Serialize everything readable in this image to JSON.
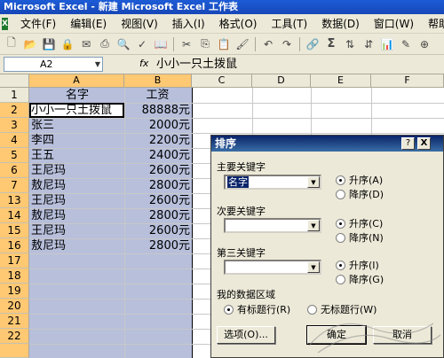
{
  "window": {
    "title": "Microsoft Excel - 新建 Microsoft Excel 工作表"
  },
  "menu": {
    "app_icon": "X",
    "items": [
      "文件(F)",
      "编辑(E)",
      "视图(V)",
      "插入(I)",
      "格式(O)",
      "工具(T)",
      "数据(D)",
      "窗口(W)",
      "帮助(H)"
    ]
  },
  "toolbar": {
    "sigma": "Σ"
  },
  "formula": {
    "cell_ref": "A2",
    "fx": "fx",
    "content": "小小一只土拨鼠"
  },
  "sheet": {
    "columns": [
      "A",
      "B",
      "C",
      "D",
      "E",
      "F"
    ],
    "row_numbers": [
      "1",
      "2",
      "3",
      "4",
      "5",
      "6",
      "7",
      "13",
      "14",
      "15",
      "16",
      "17",
      "18",
      "19",
      "20",
      "21",
      "22"
    ],
    "header": {
      "a": "名字",
      "b": "工资"
    },
    "rows": [
      {
        "name": "小小一只土拨鼠",
        "salary": "88888元"
      },
      {
        "name": "张三",
        "salary": "2000元"
      },
      {
        "name": "李四",
        "salary": "2200元"
      },
      {
        "name": "王五",
        "salary": "2400元"
      },
      {
        "name": "王尼玛",
        "salary": "2600元"
      },
      {
        "name": "敖尼玛",
        "salary": "2800元"
      },
      {
        "name": "王尼玛",
        "salary": "2600元"
      },
      {
        "name": "敖尼玛",
        "salary": "2800元"
      },
      {
        "name": "王尼玛",
        "salary": "2600元"
      },
      {
        "name": "敖尼玛",
        "salary": "2800元"
      }
    ]
  },
  "dialog": {
    "title": "排序",
    "help": "?",
    "close": "X",
    "primary_key_label": "主要关键字",
    "primary_key_value": "名字",
    "secondary_key_label": "次要关键字",
    "tertiary_key_label": "第三关键字",
    "asc": [
      "升序(A)",
      "升序(C)",
      "升序(I)"
    ],
    "desc": [
      "降序(D)",
      "降序(N)",
      "降序(G)"
    ],
    "range_label": "我的数据区域",
    "has_header": "有标题行(R)",
    "no_header": "无标题行(W)",
    "options_button": "选项(O)...",
    "ok_button": "确定",
    "cancel_button": "取消"
  },
  "colors": {
    "selection": "#b7bfdb",
    "header_selected": "#ffc873",
    "title_bar": "#1d5cd6",
    "dialog_title": "#0a246a"
  }
}
